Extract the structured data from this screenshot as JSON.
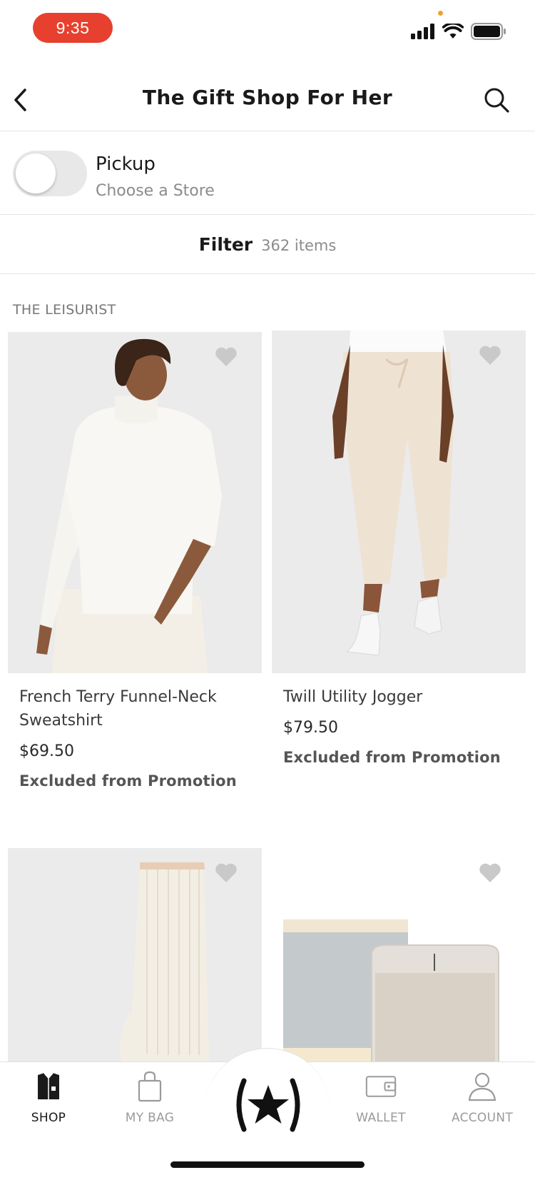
{
  "status_bar": {
    "time": "9:35"
  },
  "header": {
    "title": "The Gift Shop For Her"
  },
  "pickup": {
    "label": "Pickup",
    "sublabel": "Choose a Store",
    "enabled": false
  },
  "filter": {
    "label": "Filter",
    "count": "362 items"
  },
  "section": {
    "brand": "THE LEISURIST"
  },
  "products": [
    {
      "name_line1": "French Terry Funnel-Neck",
      "name_line2": "Sweatshirt",
      "price": "$69.50",
      "promo": "Excluded from Promotion"
    },
    {
      "name_line1": "Twill Utility Jogger",
      "price": "$79.50",
      "promo": "Excluded from Promotion"
    },
    {
      "name_line1": "",
      "price": "",
      "promo": ""
    },
    {
      "name_line1": "",
      "price": "",
      "promo": ""
    }
  ],
  "tabbar": {
    "shop": "SHOP",
    "bag": "MY BAG",
    "wallet": "WALLET",
    "account": "ACCOUNT"
  },
  "colors": {
    "accent": "#e8402e",
    "text": "#1a1a1a",
    "muted": "#8b8b8b",
    "image_bg": "#ececec"
  }
}
